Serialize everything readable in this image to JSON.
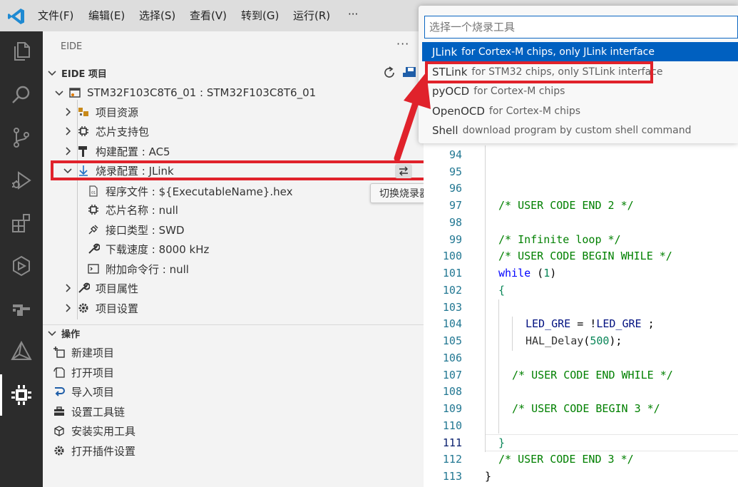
{
  "menubar": {
    "items": [
      "文件(F)",
      "编辑(E)",
      "选择(S)",
      "查看(V)",
      "转到(G)",
      "运行(R)",
      "···"
    ]
  },
  "activity_bar": {
    "icons": [
      "explorer-icon",
      "search-icon",
      "source-control-icon",
      "run-debug-icon",
      "extensions-icon",
      "remote-icon",
      "git-graph-icon",
      "cmake-icon",
      "eide-chip-icon"
    ],
    "active": "eide-chip-icon"
  },
  "sidebar": {
    "title": "EIDE",
    "more": "···",
    "project_section": "EIDE 项目",
    "project": "STM32F103C8T6_01 : STM32F103C8T6_01",
    "nodes": {
      "resources": "项目资源",
      "chip_pack": "芯片支持包",
      "build_config": "构建配置 : AC5",
      "flash_config": "烧录配置 : JLink",
      "program_file": "程序文件 : ${ExecutableName}.hex",
      "chip_name": "芯片名称 : null",
      "interface_type": "接口类型 : SWD",
      "download_speed": "下载速度 : 8000 kHz",
      "extra_cmdline": "附加命令行 : null",
      "project_attrs": "项目属性",
      "project_settings": "项目设置"
    },
    "switch_tooltip": "切换烧录器",
    "ops_section": "操作",
    "ops": {
      "new_project": "新建项目",
      "open_project": "打开项目",
      "import_project": "导入项目",
      "toolchain": "设置工具链",
      "install_tools": "安装实用工具",
      "plugin_settings": "打开插件设置"
    }
  },
  "quick_pick": {
    "placeholder": "选择一个烧录工具",
    "items": [
      {
        "label": "JLink",
        "desc": "for Cortex-M chips, only JLink interface"
      },
      {
        "label": "STLink",
        "desc": "for STM32 chips, only STLink interface"
      },
      {
        "label": "pyOCD",
        "desc": "for Cortex-M chips"
      },
      {
        "label": "OpenOCD",
        "desc": "for Cortex-M chips"
      },
      {
        "label": "Shell",
        "desc": "download program by custom shell command"
      }
    ]
  },
  "editor": {
    "lines": [
      {
        "n": "94"
      },
      {
        "n": "95"
      },
      {
        "n": "96"
      },
      {
        "n": "97"
      },
      {
        "n": "98"
      },
      {
        "n": "99"
      },
      {
        "n": "100"
      },
      {
        "n": "101"
      },
      {
        "n": "102"
      },
      {
        "n": "103"
      },
      {
        "n": "104"
      },
      {
        "n": "105"
      },
      {
        "n": "106"
      },
      {
        "n": "107"
      },
      {
        "n": "108"
      },
      {
        "n": "109"
      },
      {
        "n": "110"
      },
      {
        "n": "111"
      },
      {
        "n": "112"
      },
      {
        "n": "113"
      }
    ],
    "current_line": "111",
    "code": {
      "user_code_end_2": "/* USER CODE END 2 */",
      "infinite_loop": "/* Infinite loop */",
      "user_code_begin_while": "/* USER CODE BEGIN WHILE */",
      "while_kw": "while",
      "while_open": " (",
      "while_num": "1",
      "while_close": ")",
      "brace_open": "{",
      "led_var": "LED_GRE",
      "assign": " = !",
      "led_var2": "LED_GRE",
      "semi": " ;",
      "hal_fn": "HAL_Delay",
      "hal_open": "(",
      "hal_num": "500",
      "hal_close": ");",
      "user_code_end_while": "/* USER CODE END WHILE */",
      "user_code_begin_3": "/* USER CODE BEGIN 3 */",
      "brace_close": "}",
      "user_code_end_3": "/* USER CODE END 3 */",
      "func_close": "}"
    }
  },
  "colors": {
    "highlight_red": "#e0222b",
    "selection_blue": "#0060c0",
    "activity_bar": "#2c2c2c"
  }
}
